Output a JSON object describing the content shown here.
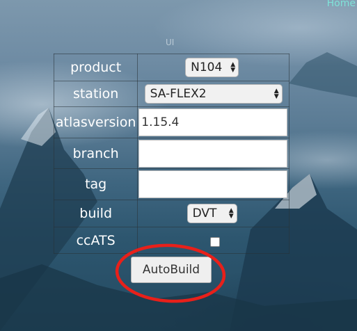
{
  "nav": {
    "home_label": "Home"
  },
  "panel": {
    "title": "UI"
  },
  "form": {
    "product": {
      "label": "product",
      "value": "N104"
    },
    "station": {
      "label": "station",
      "value": "SA-FLEX2"
    },
    "atlasversion": {
      "label": "atlasversion",
      "value": "1.15.4"
    },
    "branch": {
      "label": "branch",
      "value": ""
    },
    "tag": {
      "label": "tag",
      "value": ""
    },
    "build": {
      "label": "build",
      "value": "DVT"
    },
    "ccats": {
      "label": "ccATS",
      "checked": false
    }
  },
  "actions": {
    "autobuild_label": "AutoBuild"
  },
  "annotation": {
    "highlight_color": "#e8201a"
  },
  "colors": {
    "home_link": "#7fe3d9"
  }
}
